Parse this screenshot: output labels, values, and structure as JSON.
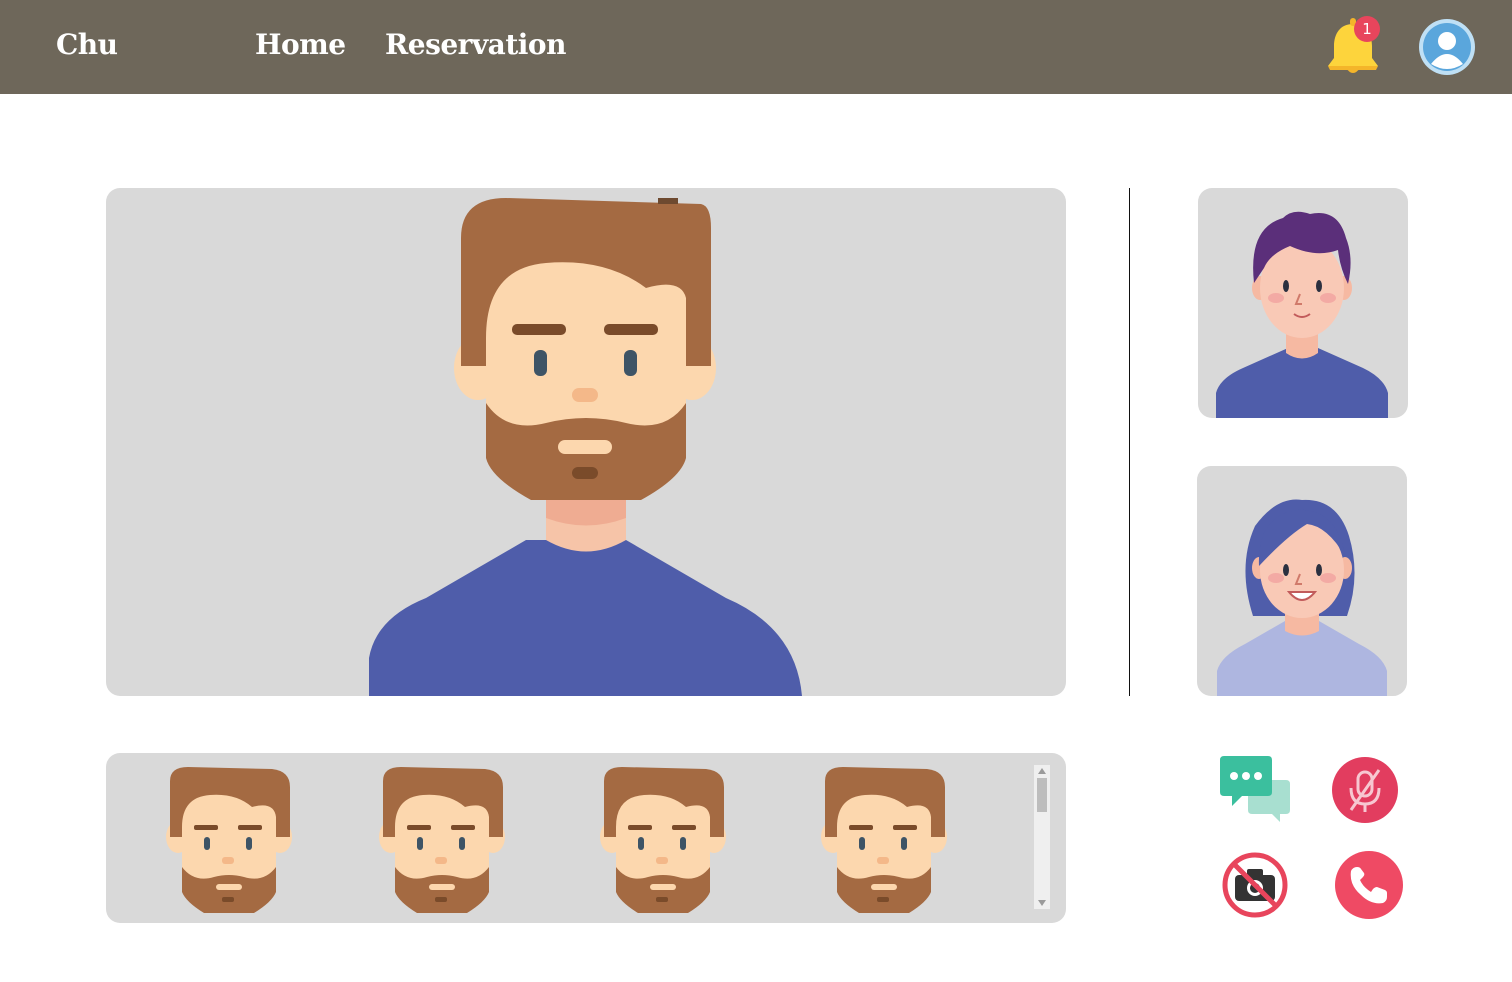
{
  "header": {
    "brand": "Chu",
    "nav": [
      {
        "label": "Home"
      },
      {
        "label": "Reservation"
      }
    ],
    "notifications": {
      "icon": "bell-icon",
      "count": "1"
    },
    "profile": {
      "icon": "user-avatar-icon"
    }
  },
  "call": {
    "main_participant": {
      "avatar": "bearded-man-avatar"
    },
    "side_participants": [
      {
        "avatar": "purple-hair-person-avatar"
      },
      {
        "avatar": "blue-hair-woman-avatar"
      }
    ],
    "strip_participants": [
      {
        "avatar": "bearded-man-avatar"
      },
      {
        "avatar": "bearded-man-avatar"
      },
      {
        "avatar": "bearded-man-avatar"
      },
      {
        "avatar": "bearded-man-avatar"
      }
    ],
    "controls": [
      {
        "name": "chat",
        "icon": "chat-bubbles-icon"
      },
      {
        "name": "mute",
        "icon": "microphone-off-icon"
      },
      {
        "name": "camera",
        "icon": "camera-off-icon"
      },
      {
        "name": "end-call",
        "icon": "phone-icon"
      }
    ]
  },
  "colors": {
    "header_bg": "#6e675a",
    "tile_bg": "#d9d9d9",
    "skin": "#fcd7ae",
    "beard": "#a46a42",
    "shirt": "#4f5daa",
    "danger": "#e8455c",
    "chat": "#3bbf9e"
  }
}
